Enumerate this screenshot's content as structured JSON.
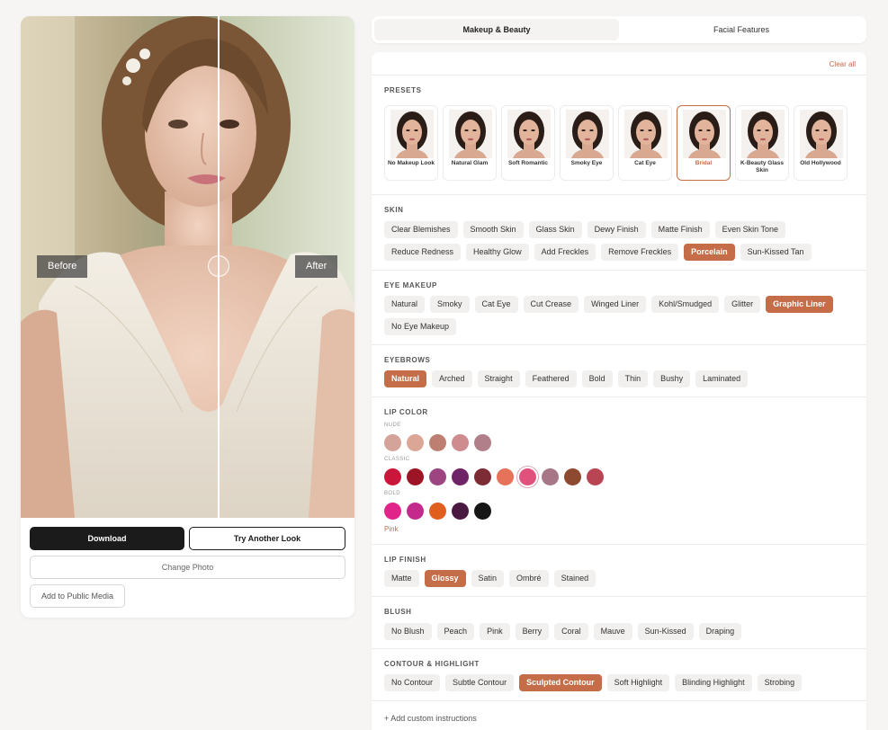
{
  "left": {
    "before_label": "Before",
    "after_label": "After",
    "buttons": {
      "download": "Download",
      "try_another": "Try Another Look",
      "change_photo": "Change Photo",
      "add_public": "Add to Public Media"
    }
  },
  "tabs": [
    {
      "label": "Makeup & Beauty",
      "active": true
    },
    {
      "label": "Facial Features",
      "active": false
    }
  ],
  "panel": {
    "clear_all": "Clear all",
    "presets": {
      "title": "PRESETS",
      "items": [
        "No Makeup Look",
        "Natural Glam",
        "Soft Romantic",
        "Smoky Eye",
        "Cat Eye",
        "Bridal",
        "K-Beauty Glass Skin",
        "Old Hollywood"
      ],
      "selected": "Bridal"
    },
    "skin": {
      "title": "SKIN",
      "options": [
        "Clear Blemishes",
        "Smooth Skin",
        "Glass Skin",
        "Dewy Finish",
        "Matte Finish",
        "Even Skin Tone",
        "Reduce Redness",
        "Healthy Glow",
        "Add Freckles",
        "Remove Freckles",
        "Porcelain",
        "Sun-Kissed Tan"
      ],
      "selected": "Porcelain"
    },
    "eye_makeup": {
      "title": "EYE MAKEUP",
      "options": [
        "Natural",
        "Smoky",
        "Cat Eye",
        "Cut Crease",
        "Winged Liner",
        "Kohl/Smudged",
        "Glitter",
        "Graphic Liner",
        "No Eye Makeup"
      ],
      "selected": "Graphic Liner"
    },
    "eyebrows": {
      "title": "EYEBROWS",
      "options": [
        "Natural",
        "Arched",
        "Straight",
        "Feathered",
        "Bold",
        "Thin",
        "Bushy",
        "Laminated"
      ],
      "selected": "Natural"
    },
    "lip_color": {
      "title": "LIP COLOR",
      "groups": [
        {
          "label": "NUDE",
          "colors": [
            "#d4a39a",
            "#dba696",
            "#bd7f72",
            "#cf8c8e",
            "#b07f8a"
          ]
        },
        {
          "label": "CLASSIC",
          "colors": [
            "#c8173a",
            "#9c1425",
            "#9c4580",
            "#6e2466",
            "#7d2c35",
            "#e6725a",
            "#e0527c",
            "#a77787",
            "#8e4a30",
            "#b94453"
          ]
        },
        {
          "label": "BOLD",
          "colors": [
            "#e0248a",
            "#c42a8c",
            "#e05e1e",
            "#4a1942",
            "#161616"
          ]
        }
      ],
      "selected_color": "#e0527c",
      "selected_name": "Pink"
    },
    "lip_finish": {
      "title": "LIP FINISH",
      "options": [
        "Matte",
        "Glossy",
        "Satin",
        "Ombré",
        "Stained"
      ],
      "selected": "Glossy"
    },
    "blush": {
      "title": "BLUSH",
      "options": [
        "No Blush",
        "Peach",
        "Pink",
        "Berry",
        "Coral",
        "Mauve",
        "Sun-Kissed",
        "Draping"
      ],
      "selected": ""
    },
    "contour": {
      "title": "CONTOUR & HIGHLIGHT",
      "options": [
        "No Contour",
        "Subtle Contour",
        "Sculpted Contour",
        "Soft Highlight",
        "Blinding Highlight",
        "Strobing"
      ],
      "selected": "Sculpted Contour"
    },
    "add_custom": "+ Add custom instructions"
  },
  "colors": {
    "accent": "#c46d48",
    "dark_button": "#1b1b1b"
  }
}
